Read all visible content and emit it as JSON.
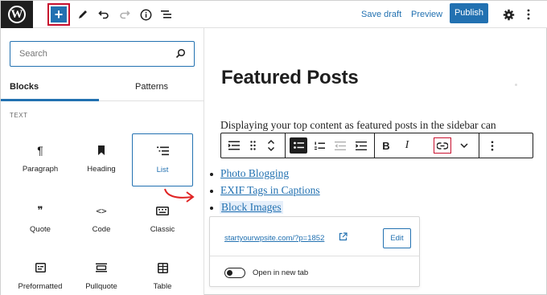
{
  "topbar": {
    "logo_icon": "wordpress-logo",
    "logo_letter": "W",
    "inserter_symbol": "+",
    "save_draft": "Save draft",
    "preview": "Preview",
    "publish": "Publish",
    "icons": [
      "plus-icon",
      "pencil-icon",
      "undo-icon",
      "redo-icon",
      "info-icon",
      "list-view-icon",
      "gear-icon",
      "more-vertical-icon"
    ]
  },
  "sidebar": {
    "search_placeholder": "Search",
    "tabs": [
      {
        "label": "Blocks",
        "active": true
      },
      {
        "label": "Patterns",
        "active": false
      }
    ],
    "section": "TEXT",
    "blocks": [
      {
        "label": "Paragraph",
        "icon": "paragraph-icon",
        "glyph": "¶",
        "selected": false
      },
      {
        "label": "Heading",
        "icon": "bookmark-icon",
        "glyph": "",
        "selected": false
      },
      {
        "label": "List",
        "icon": "list-icon",
        "glyph": "",
        "selected": true
      },
      {
        "label": "Quote",
        "icon": "quote-icon",
        "glyph": "❞",
        "selected": false
      },
      {
        "label": "Code",
        "icon": "code-icon",
        "glyph": "<>",
        "selected": false
      },
      {
        "label": "Classic",
        "icon": "keyboard-icon",
        "glyph": "",
        "selected": false
      },
      {
        "label": "Preformatted",
        "icon": "preformatted-icon",
        "glyph": "",
        "selected": false
      },
      {
        "label": "Pullquote",
        "icon": "pullquote-icon",
        "glyph": "",
        "selected": false
      },
      {
        "label": "Table",
        "icon": "table-icon",
        "glyph": "",
        "selected": false
      }
    ]
  },
  "editor": {
    "title": "Featured Posts",
    "paragraph": "Displaying your top content as featured posts in the sidebar can",
    "block_toolbar": {
      "bold": "B",
      "italic": "I",
      "icons": [
        "align-icon",
        "drag-handle-icon",
        "move-up-down-icon",
        "unordered-list-icon",
        "ordered-list-icon",
        "outdent-icon",
        "indent-icon",
        "bold-icon",
        "italic-icon",
        "link-icon",
        "chevron-down-icon",
        "more-vertical-icon"
      ]
    },
    "list_items": [
      "Photo Blogging",
      "EXIF Tags in Captions",
      "Block Images"
    ],
    "link_popover": {
      "url": "startyourwpsite.com/?p=1852",
      "edit_label": "Edit",
      "toggle_label": "Open in new tab",
      "toggle_on": false
    }
  },
  "colors": {
    "accent": "#2271b1",
    "highlight_red": "#c8102e",
    "dark": "#1e1e1e"
  }
}
